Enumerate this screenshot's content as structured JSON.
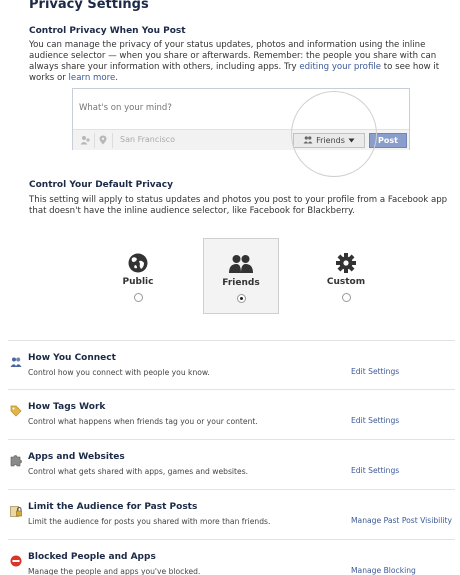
{
  "page_title": "Privacy Settings",
  "section1": {
    "heading": "Control Privacy When You Post",
    "para_1": "You can manage the privacy of your status updates, photos and information using the inline audience selector — when you share or afterwards. Remember: the people you share with can always share your information with others, including apps. Try ",
    "link_1": "editing your profile",
    "para_2": " to see how it works or ",
    "link_2": "learn more",
    "para_3": "."
  },
  "composer": {
    "placeholder": "What's on your mind?",
    "location": "San Francisco",
    "audience": "Friends",
    "post_label": "Post",
    "icons": [
      "person-tag-icon",
      "location-pin-icon"
    ]
  },
  "section2": {
    "heading": "Control Your Default Privacy",
    "para": "This setting will apply to status updates and photos you post to your profile from a Facebook app that doesn't have the inline audience selector, like Facebook for Blackberry."
  },
  "default_options": [
    {
      "label": "Public",
      "icon": "globe-icon",
      "selected": false
    },
    {
      "label": "Friends",
      "icon": "friends-icon",
      "selected": true
    },
    {
      "label": "Custom",
      "icon": "gear-icon",
      "selected": false
    }
  ],
  "settings_rows": [
    {
      "title": "How You Connect",
      "desc": "Control how you connect with people you know.",
      "link": "Edit Settings",
      "icon": "people-icon"
    },
    {
      "title": "How Tags Work",
      "desc": "Control what happens when friends tag you or your content.",
      "link": "Edit Settings",
      "icon": "tag-icon"
    },
    {
      "title": "Apps and Websites",
      "desc": "Control what gets shared with apps, games and websites.",
      "link": "Edit Settings",
      "icon": "puzzle-icon"
    },
    {
      "title": "Limit the Audience for Past Posts",
      "desc": "Limit the audience for posts you shared with more than friends.",
      "link": "Manage Past Post Visibility",
      "icon": "lock-icon"
    },
    {
      "title": "Blocked People and Apps",
      "desc": "Manage the people and apps you've blocked.",
      "link": "Manage Blocking",
      "icon": "block-icon"
    }
  ],
  "colors": {
    "link": "#3b5998",
    "heading": "#1c2a47",
    "post_button": "#8a9dcb"
  }
}
